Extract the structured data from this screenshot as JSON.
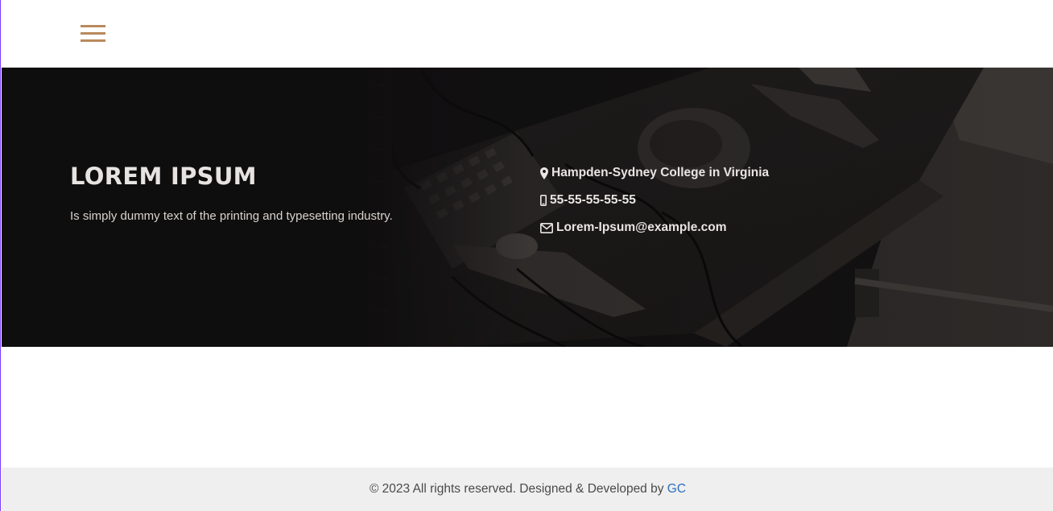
{
  "header": {
    "menu_icon": "hamburger-menu-icon",
    "accent_color": "#b98a5c"
  },
  "hero": {
    "title": "LOREM IPSUM",
    "subtitle": "Is simply dummy text of the printing and typesetting industry.",
    "contact": {
      "address": "Hampden-Sydney College in Virginia",
      "address_icon": "map-marker-icon",
      "phone": "55-55-55-55-55",
      "phone_icon": "mobile-phone-icon",
      "email": "Lorem-Ipsum@example.com",
      "email_icon": "envelope-icon"
    }
  },
  "footer": {
    "text": "© 2023 All rights reserved. Designed & Developed by",
    "link_label": "GC",
    "link_color": "#2a6fbe"
  }
}
